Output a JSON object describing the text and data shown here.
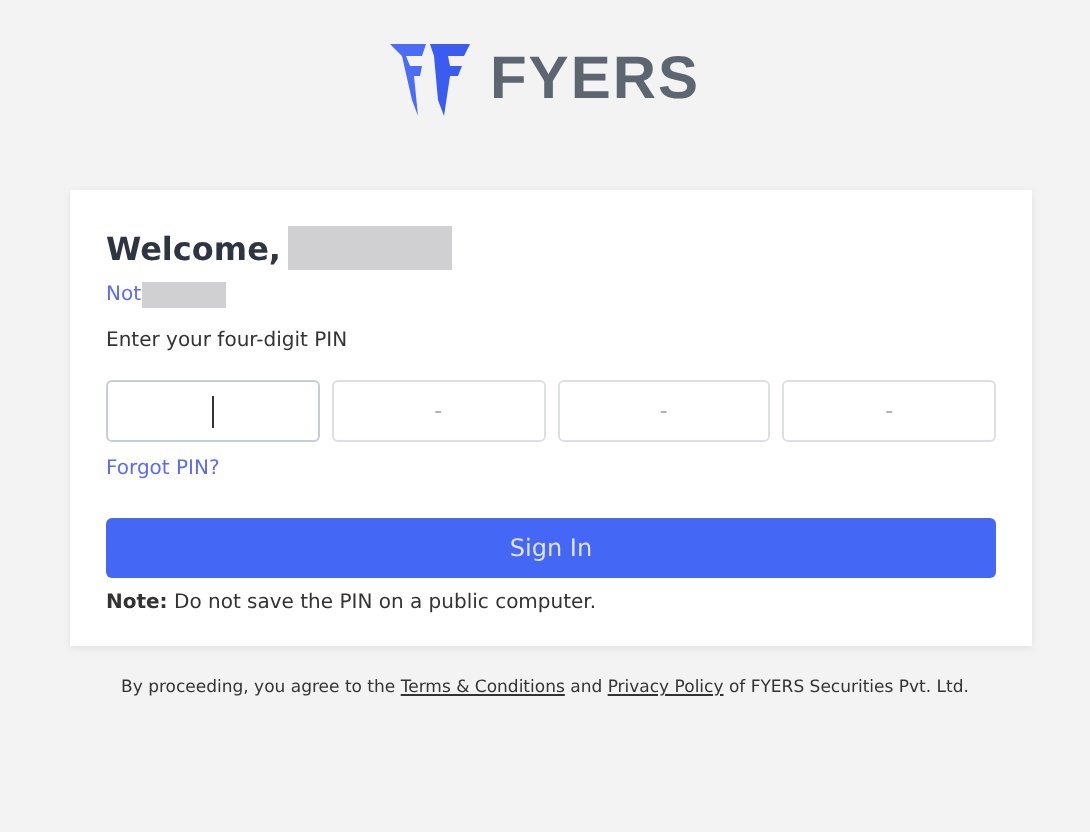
{
  "logo": {
    "wordmark": "FYERS"
  },
  "card": {
    "heading": "Welcome,",
    "not_user_link": "Not",
    "pin_label": "Enter your four-digit PIN",
    "pin_fields": [
      {
        "focused": true
      },
      {
        "placeholder": "-",
        "focused": false
      },
      {
        "placeholder": "-",
        "focused": false
      },
      {
        "placeholder": "-",
        "focused": false
      }
    ],
    "forgot_link": "Forgot PIN?",
    "submit_button": "Sign In",
    "note": "**Note:** Do not save the PIN on a public computer."
  },
  "footer": [
    {
      "kind": "text",
      "text": "By proceeding, you agree to the"
    },
    {
      "kind": "link",
      "text": "Terms & Conditions"
    },
    {
      "kind": "text",
      "text": "and"
    },
    {
      "kind": "link",
      "text": "Privacy Policy"
    },
    {
      "kind": "text",
      "text": "of FYERS Securities Pvt. Ltd."
    }
  ]
}
